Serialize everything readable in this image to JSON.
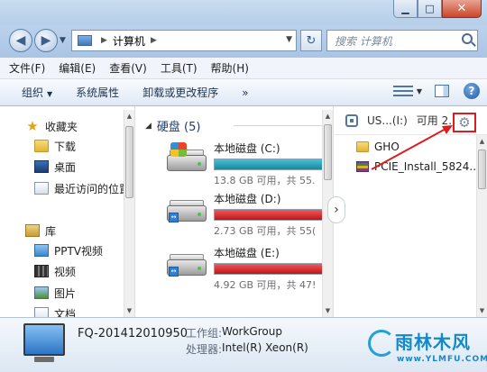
{
  "window": {
    "minimize_glyph": "▁",
    "maximize_glyph": "□",
    "close_glyph": "✕"
  },
  "address_bar": {
    "crumbs": [
      "计算机"
    ],
    "separator_glyph": "▶",
    "search_placeholder": "搜索 计算机"
  },
  "menu": [
    "文件(F)",
    "编辑(E)",
    "查看(V)",
    "工具(T)",
    "帮助(H)"
  ],
  "command_bar": {
    "items": [
      "组织",
      "系统属性",
      "卸载或更改程序"
    ],
    "overflow": "»",
    "help_glyph": "?"
  },
  "nav_pane": {
    "favorites": {
      "label": "收藏夹",
      "items": [
        "下载",
        "桌面",
        "最近访问的位置"
      ]
    },
    "libraries": {
      "label": "库",
      "items": [
        "PPTV视频",
        "视频",
        "图片",
        "文档"
      ]
    }
  },
  "content": {
    "group_label": "硬盘 (5)",
    "drives": [
      {
        "name": "本地磁盘 (C:)",
        "free_text": "13.8 GB 可用，共 55.",
        "used_fraction": 0.75,
        "color": "#17879c"
      },
      {
        "name": "本地磁盘 (D:)",
        "free_text": "2.73 GB 可用，共 55(",
        "used_fraction": 0.95,
        "color": "#c01515"
      },
      {
        "name": "本地磁盘 (E:)",
        "free_text": "4.92 GB 可用，共 47!",
        "used_fraction": 0.92,
        "color": "#c01515"
      }
    ]
  },
  "preview": {
    "device_name": "US...(I:)",
    "device_free": "可用 2.",
    "files": [
      "GHO",
      "PCIE_Install_5824..."
    ],
    "expand_glyph": "›",
    "highlight_color": "#d81e1e"
  },
  "details": {
    "computer_name": "FQ-201412010950",
    "workgroup_label": "工作组:",
    "workgroup_value": "WorkGroup",
    "cpu_label": "处理器:",
    "cpu_value": "Intel(R) Xeon(R)"
  },
  "watermark": {
    "text": "雨林木风",
    "url": "www.YLMFU.COM"
  }
}
